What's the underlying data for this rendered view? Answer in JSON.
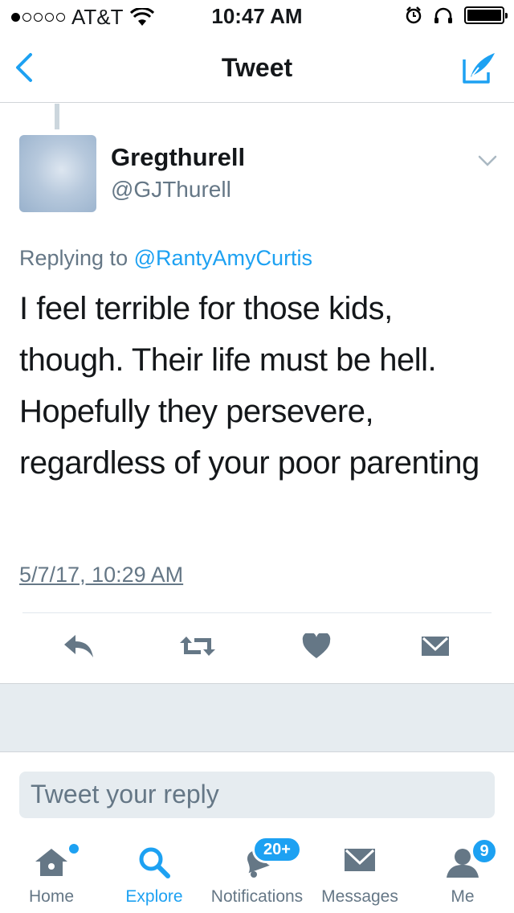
{
  "status_bar": {
    "carrier": "AT&T",
    "time": "10:47 AM"
  },
  "nav": {
    "title": "Tweet"
  },
  "tweet": {
    "display_name": "Gregthurell",
    "handle": "@GJThurell",
    "replying_prefix": "Replying to",
    "replying_to": "@RantyAmyCurtis",
    "text": "I feel terrible for those kids, though. Their life must be hell. Hopefully they persevere, regardless of your poor parenting",
    "timestamp": "5/7/17, 10:29 AM"
  },
  "reply": {
    "placeholder": "Tweet your reply"
  },
  "tab_bar": {
    "tabs": [
      {
        "label": "Home",
        "icon": "home-icon"
      },
      {
        "label": "Explore",
        "icon": "search-icon"
      },
      {
        "label": "Notifications",
        "icon": "bell-icon",
        "badge": "20+"
      },
      {
        "label": "Messages",
        "icon": "envelope-icon"
      },
      {
        "label": "Me",
        "icon": "person-icon",
        "badge": "9"
      }
    ],
    "active": "Explore"
  },
  "colors": {
    "accent": "#1da1f2",
    "secondary_text": "#657786",
    "icon_gray": "#657786",
    "separator_bg": "#e6ecf0"
  }
}
